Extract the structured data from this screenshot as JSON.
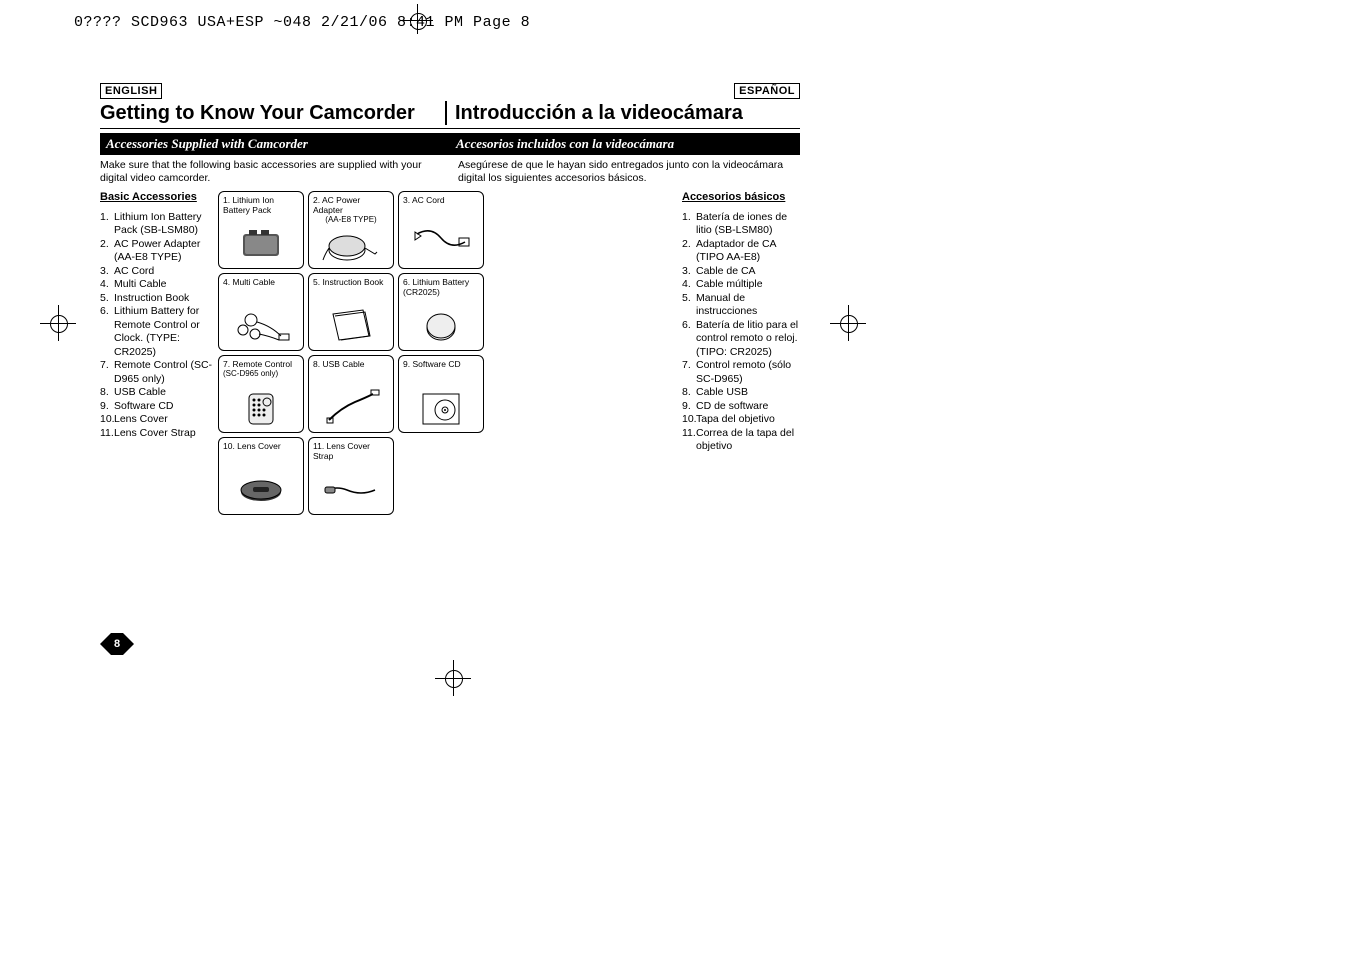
{
  "slug": "0????  SCD963 USA+ESP ~048  2/21/06 8:41 PM  Page 8",
  "page_number": "8",
  "lang_left": "ENGLISH",
  "lang_right": "ESPAÑOL",
  "title_en": "Getting to Know Your Camcorder",
  "title_es": "Introducción a la videocámara",
  "subtitle_en": "Accessories Supplied with Camcorder",
  "subtitle_es": "Accesorios incluidos con la videocámara",
  "desc_en": "Make sure that the following basic accessories are supplied with your digital video camcorder.",
  "desc_es": "Asegúrese de que le hayan sido entregados junto con la videocámara digital los siguientes accesorios básicos.",
  "heading_en": "Basic Accessories",
  "heading_es": "Accesorios básicos",
  "list_en": [
    {
      "n": "1.",
      "t": "Lithium Ion Battery Pack (SB-LSM80)"
    },
    {
      "n": "2.",
      "t": "AC Power Adapter (AA-E8 TYPE)"
    },
    {
      "n": "3.",
      "t": "AC Cord"
    },
    {
      "n": "4.",
      "t": "Multi Cable"
    },
    {
      "n": "5.",
      "t": "Instruction Book"
    },
    {
      "n": "6.",
      "t": "Lithium Battery for Remote Control or Clock. (TYPE: CR2025)"
    },
    {
      "n": "7.",
      "t": "Remote Control (SC-D965 only)"
    },
    {
      "n": "8.",
      "t": "USB Cable"
    },
    {
      "n": "9.",
      "t": "Software CD"
    },
    {
      "n": "10.",
      "t": "Lens Cover"
    },
    {
      "n": "11.",
      "t": "Lens Cover Strap"
    }
  ],
  "list_es": [
    {
      "n": "1.",
      "t": "Batería de iones de litio (SB-LSM80)"
    },
    {
      "n": "2.",
      "t": "Adaptador de CA (TIPO AA-E8)"
    },
    {
      "n": "3.",
      "t": "Cable de CA"
    },
    {
      "n": "4.",
      "t": "Cable múltiple"
    },
    {
      "n": "5.",
      "t": "Manual de instrucciones"
    },
    {
      "n": "6.",
      "t": "Batería de litio para el control remoto o reloj. (TIPO: CR2025)"
    },
    {
      "n": "7.",
      "t": "Control remoto (sólo SC-D965)"
    },
    {
      "n": "8.",
      "t": "Cable USB"
    },
    {
      "n": "9.",
      "t": "CD de software"
    },
    {
      "n": "10.",
      "t": "Tapa del objetivo"
    },
    {
      "n": "11.",
      "t": "Correa de la tapa del objetivo"
    }
  ],
  "grid": [
    {
      "label": "1. Lithium Ion Battery Pack",
      "sub": "",
      "icon": "battery"
    },
    {
      "label": "2. AC Power Adapter",
      "sub": "(AA-E8 TYPE)",
      "icon": "adapter"
    },
    {
      "label": "3. AC Cord",
      "sub": "",
      "icon": "cord"
    },
    {
      "label": "4. Multi Cable",
      "sub": "",
      "icon": "multicable"
    },
    {
      "label": "5. Instruction Book",
      "sub": "",
      "icon": "book"
    },
    {
      "label": "6. Lithium Battery (CR2025)",
      "sub": "",
      "icon": "coin"
    },
    {
      "label": "7. Remote Control",
      "sub": "(SC-D965 only)",
      "icon": "remote"
    },
    {
      "label": "8. USB Cable",
      "sub": "",
      "icon": "usb"
    },
    {
      "label": "9. Software CD",
      "sub": "",
      "icon": "cd"
    },
    {
      "label": "10. Lens Cover",
      "sub": "",
      "icon": "lenscover"
    },
    {
      "label": "11. Lens Cover Strap",
      "sub": "",
      "icon": "strap"
    }
  ]
}
